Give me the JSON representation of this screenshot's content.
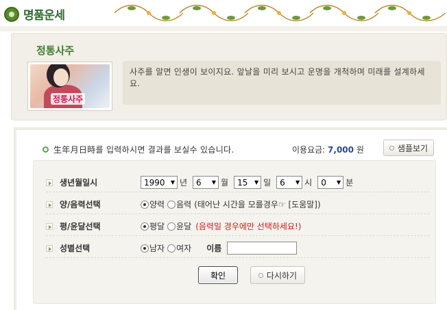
{
  "header": {
    "logo_text": "명품운세",
    "logo_icon": "round-logo-icon",
    "ornament_icon": "floral-scroll-ornament"
  },
  "intro": {
    "title": "정통사주",
    "thumbnail_label": "정통사주",
    "description": "사주를 알면 인생이 보이지요. 앞날을 미리 보시고 운명을 개척하며 미래를 설계하세요."
  },
  "form": {
    "notice": "生年月日時를 입력하시면 결과를 보실수 있습니다.",
    "fee_label": "이용요금:",
    "fee_value": "7,000",
    "fee_unit": "원",
    "sample_button": "샘플보기",
    "rows": {
      "birth": {
        "label": "생년월일시",
        "year": "1990",
        "year_unit": "년",
        "month": "6",
        "month_unit": "월",
        "day": "15",
        "day_unit": "일",
        "hour": "6",
        "hour_unit": "시",
        "minute": "0",
        "minute_unit": "분"
      },
      "calendar": {
        "label": "양/음력선택",
        "solar": "양력",
        "lunar": "음력",
        "note": "(태어난 시간을 모를경우☞ [도움말])"
      },
      "leap": {
        "label": "평/윤달선택",
        "normal": "평달",
        "leap": "윤달",
        "note": "(음력일 경우에만 선택하세요!)"
      },
      "gender": {
        "label": "성별선택",
        "male": "남자",
        "female": "여자",
        "name_label": "이름",
        "name_value": ""
      }
    },
    "confirm_button": "확인",
    "reset_button": "다시하기"
  },
  "colors": {
    "brand_green": "#3f7f2f",
    "fee_blue": "#2a4a8a",
    "warning_red": "#d21b1b",
    "panel_beige": "#f1efe7"
  }
}
